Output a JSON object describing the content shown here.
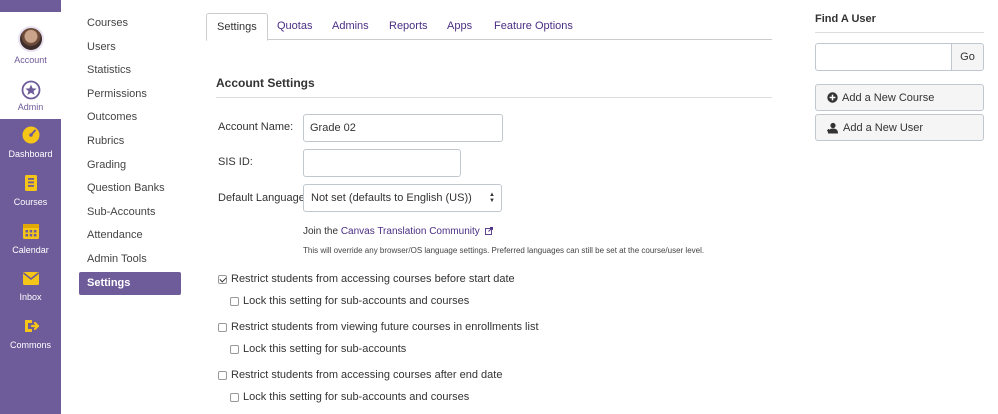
{
  "global_nav": {
    "items": [
      {
        "label": "Account",
        "icon": "avatar"
      },
      {
        "label": "Admin",
        "icon": "shield-star-icon"
      },
      {
        "label": "Dashboard",
        "icon": "speedometer-icon"
      },
      {
        "label": "Courses",
        "icon": "book-icon"
      },
      {
        "label": "Calendar",
        "icon": "calendar-icon"
      },
      {
        "label": "Inbox",
        "icon": "inbox-icon"
      },
      {
        "label": "Commons",
        "icon": "commons-icon"
      }
    ],
    "accent": "#6e5b99",
    "icon_color": "#f5c518"
  },
  "sub_nav": {
    "items": [
      "Courses",
      "Users",
      "Statistics",
      "Permissions",
      "Outcomes",
      "Rubrics",
      "Grading",
      "Question Banks",
      "Sub-Accounts",
      "Attendance",
      "Admin Tools",
      "Settings"
    ],
    "active": "Settings"
  },
  "tabs": [
    "Settings",
    "Quotas",
    "Admins",
    "Reports",
    "Apps",
    "Feature Options"
  ],
  "section": {
    "title": "Account Settings"
  },
  "form": {
    "account_name_label": "Account Name:",
    "account_name_value": "Grade 02",
    "sis_id_label": "SIS ID:",
    "sis_id_value": "",
    "default_language_label": "Default Language:",
    "default_language_value": "Not set (defaults to English (US))",
    "join_prefix": "Join the",
    "join_link": "Canvas Translation Community",
    "hint": "This will override any browser/OS language settings. Preferred languages can still be set at the course/user level."
  },
  "checkboxes": [
    {
      "label": "Restrict students from accessing courses before start date",
      "checked": true
    },
    {
      "label": "Lock this setting for sub-accounts and courses",
      "checked": false
    },
    {
      "label": "Restrict students from viewing future courses in enrollments list",
      "checked": false
    },
    {
      "label": "Lock this setting for sub-accounts",
      "checked": false
    },
    {
      "label": "Restrict students from accessing courses after end date",
      "checked": false
    },
    {
      "label": "Lock this setting for sub-accounts and courses",
      "checked": false
    }
  ],
  "sidebar": {
    "find_user_title": "Find A User",
    "go_label": "Go",
    "add_course_label": "Add a New Course",
    "add_user_label": "Add a New User"
  }
}
